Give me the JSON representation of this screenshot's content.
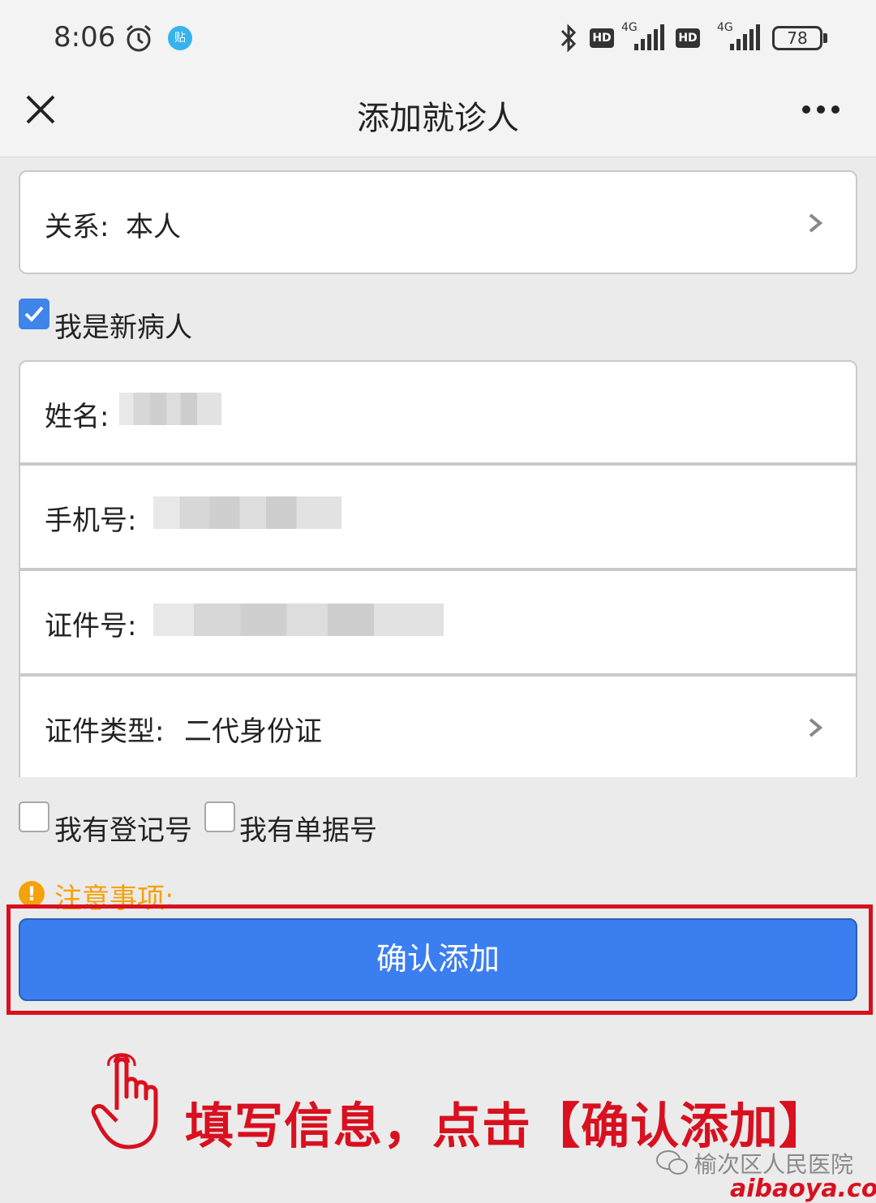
{
  "status_bar": {
    "time": "8:06",
    "notice_badge": "贴",
    "hd_1": "HD",
    "net_1": "4G",
    "hd_2": "HD",
    "net_2": "4G",
    "battery": "78"
  },
  "nav": {
    "title": "添加就诊人"
  },
  "form": {
    "relation": {
      "label": "关系:",
      "value": "本人"
    },
    "new_patient_checkbox": {
      "label": "我是新病人",
      "checked": true
    },
    "name": {
      "label": "姓名:"
    },
    "phone": {
      "label": "手机号:"
    },
    "id_number": {
      "label": "证件号:"
    },
    "id_type": {
      "label": "证件类型:",
      "value": "二代身份证"
    },
    "has_registration": {
      "label": "我有登记号",
      "checked": false
    },
    "has_receipt": {
      "label": "我有单据号",
      "checked": false
    }
  },
  "notice": {
    "label": "注意事项:"
  },
  "confirm_button": {
    "label": "确认添加"
  },
  "overlay": {
    "instruction": "填写信息，点击【确认添加】",
    "source": "榆次区人民医院",
    "site": "aibaoya.com"
  },
  "colors": {
    "accent_blue": "#3b7ef0",
    "highlight_red": "#d8101f",
    "warning_orange": "#f5a10b"
  }
}
